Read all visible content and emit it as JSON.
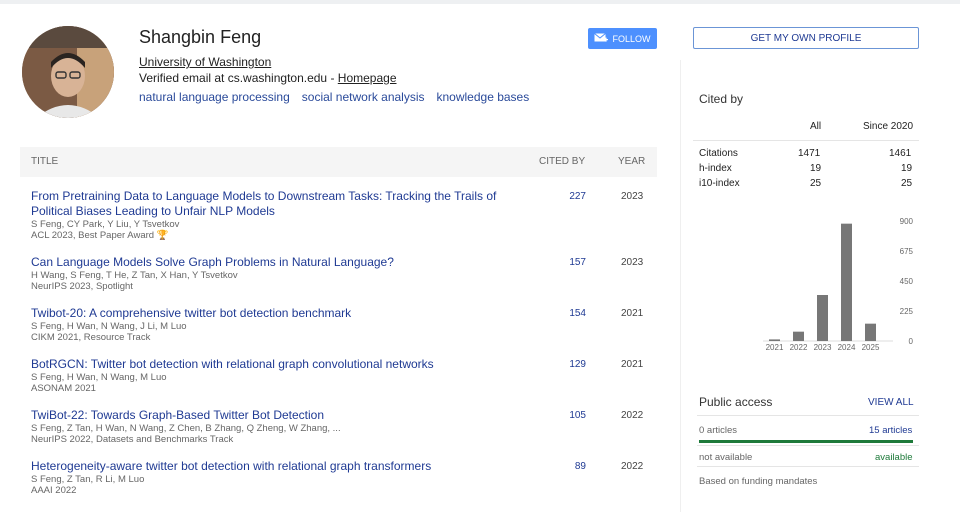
{
  "profile": {
    "name": "Shangbin Feng",
    "affiliation": "University of Washington",
    "verified": "Verified email at cs.washington.edu - ",
    "homepage": "Homepage",
    "interests": [
      "natural language processing",
      "social network analysis",
      "knowledge bases"
    ],
    "follow_label": "FOLLOW"
  },
  "table": {
    "col_title": "TITLE",
    "col_cited": "CITED BY",
    "col_year": "YEAR",
    "rows": [
      {
        "title": "From Pretraining Data to Language Models to Downstream Tasks: Tracking the Trails of Political Biases Leading to Unfair NLP Models",
        "authors": "S Feng, CY Park, Y Liu, Y Tsvetkov",
        "venue": "ACL 2023, Best Paper Award 🏆",
        "cited": "227",
        "year": "2023"
      },
      {
        "title": "Can Language Models Solve Graph Problems in Natural Language?",
        "authors": "H Wang, S Feng, T He, Z Tan, X Han, Y Tsvetkov",
        "venue": "NeurIPS 2023, Spotlight",
        "cited": "157",
        "year": "2023"
      },
      {
        "title": "Twibot-20: A comprehensive twitter bot detection benchmark",
        "authors": "S Feng, H Wan, N Wang, J Li, M Luo",
        "venue": "CIKM 2021, Resource Track",
        "cited": "154",
        "year": "2021"
      },
      {
        "title": "BotRGCN: Twitter bot detection with relational graph convolutional networks",
        "authors": "S Feng, H Wan, N Wang, M Luo",
        "venue": "ASONAM 2021",
        "cited": "129",
        "year": "2021"
      },
      {
        "title": "TwiBot-22: Towards Graph-Based Twitter Bot Detection",
        "authors": "S Feng, Z Tan, H Wan, N Wang, Z Chen, B Zhang, Q Zheng, W Zhang, ...",
        "venue": "NeurIPS 2022, Datasets and Benchmarks Track",
        "cited": "105",
        "year": "2022"
      },
      {
        "title": "Heterogeneity-aware twitter bot detection with relational graph transformers",
        "authors": "S Feng, Z Tan, R Li, M Luo",
        "venue": "AAAI 2022",
        "cited": "89",
        "year": "2022"
      }
    ]
  },
  "sidebar": {
    "own_profile": "GET MY OWN PROFILE",
    "cited_by": "Cited by",
    "col_all": "All",
    "col_since": "Since 2020",
    "metrics": [
      {
        "label": "Citations",
        "all": "1471",
        "since": "1461"
      },
      {
        "label": "h-index",
        "all": "19",
        "since": "19"
      },
      {
        "label": "i10-index",
        "all": "25",
        "since": "25"
      }
    ],
    "public_access": "Public access",
    "view_all": "VIEW ALL",
    "articles_left": "0 articles",
    "articles_right": "15 articles",
    "status_left": "not available",
    "status_right": "available",
    "note": "Based on funding mandates"
  },
  "chart_data": {
    "type": "bar",
    "categories": [
      "2021",
      "2022",
      "2023",
      "2024",
      "2025"
    ],
    "values": [
      12,
      70,
      345,
      880,
      130
    ],
    "yticks": [
      "900",
      "675",
      "450",
      "225",
      "0"
    ],
    "ylim": [
      0,
      900
    ],
    "bar_color": "#777777"
  },
  "colors": {
    "link": "#1f3a93",
    "follow_bg": "#4d90fe",
    "access_green": "#1e7a3a"
  }
}
